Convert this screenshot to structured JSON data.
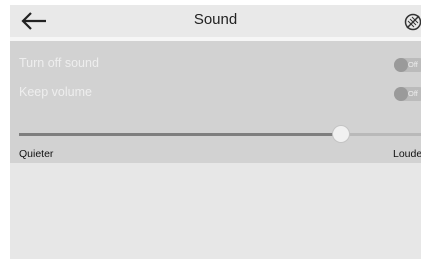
{
  "header": {
    "title": "Sound",
    "back_icon": "arrow-left-icon",
    "mute_icon": "mute-circle-icon"
  },
  "settings": [
    {
      "label": "Turn off sound",
      "toggle": "Off"
    },
    {
      "label": "Keep volume",
      "toggle": "Off"
    }
  ],
  "volume": {
    "level": 0.8,
    "min_label": "Quieter",
    "max_label": "Louder"
  },
  "colors": {
    "background": "#e7e7e7",
    "panel": "#d2d2d2",
    "slider_fill": "#7e7e7e"
  }
}
